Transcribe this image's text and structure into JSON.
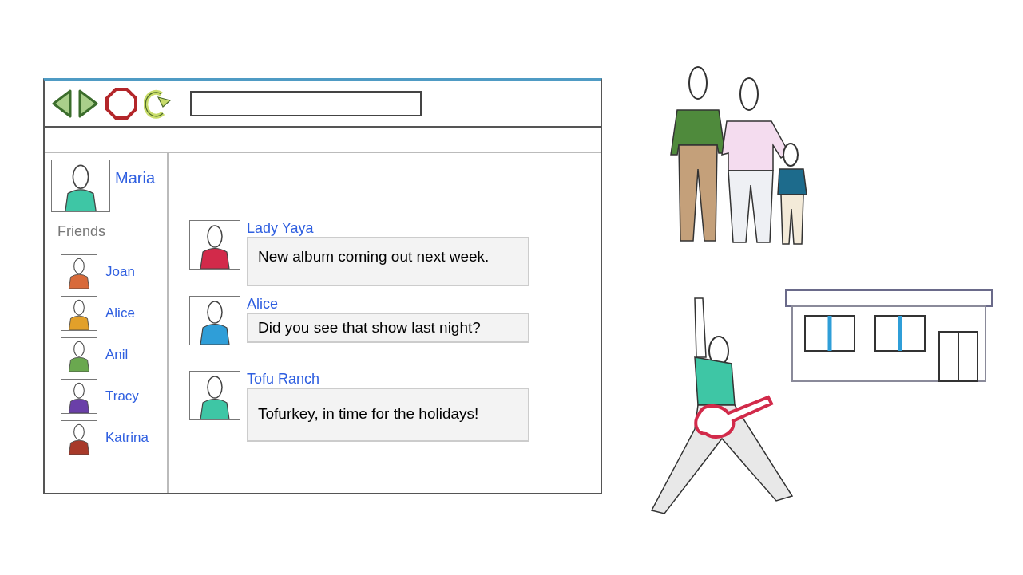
{
  "profile": {
    "name": "Maria"
  },
  "friends_heading": "Friends",
  "friends": [
    {
      "name": "Joan"
    },
    {
      "name": "Alice"
    },
    {
      "name": "Anil"
    },
    {
      "name": "Tracy"
    },
    {
      "name": "Katrina"
    }
  ],
  "feed": [
    {
      "author": "Lady Yaya",
      "message": "New album coming out next week."
    },
    {
      "author": "Alice",
      "message": "Did you see that show last night?"
    },
    {
      "author": "Tofu Ranch",
      "message": "Tofurkey, in time for the holidays!"
    }
  ]
}
